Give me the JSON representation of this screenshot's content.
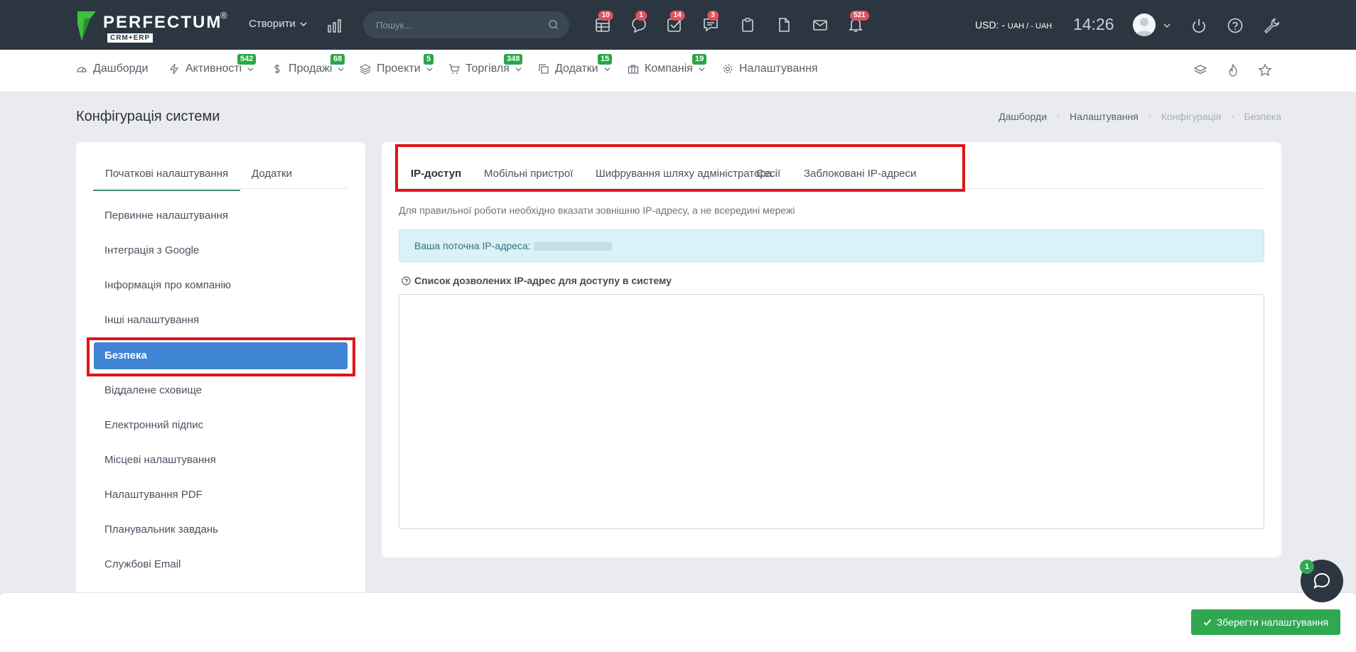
{
  "topbar": {
    "logo_text": "PERFECTUM",
    "logo_reg": "®",
    "logo_sub": "CRM+ERP",
    "create_label": "Створити",
    "search_placeholder": "Пошук...",
    "badges": {
      "tables": "10",
      "chat": "1",
      "tasks": "14",
      "messages": "3",
      "notifications": "521"
    },
    "currency_label": "USD: - ",
    "currency_mid": "UAH / - ",
    "currency_end": "UAH",
    "time": "14:26"
  },
  "nav": {
    "items": [
      {
        "label": "Дашборди"
      },
      {
        "label": "Активності",
        "badge": "542"
      },
      {
        "label": "Продажі",
        "badge": "68"
      },
      {
        "label": "Проекти",
        "badge": "5"
      },
      {
        "label": "Торгівля",
        "badge": "348"
      },
      {
        "label": "Додатки",
        "badge": "15"
      },
      {
        "label": "Компанія",
        "badge": "19"
      },
      {
        "label": "Налаштування"
      }
    ]
  },
  "page": {
    "title": "Конфігурація системи",
    "breadcrumb": [
      "Дашборди",
      "Налаштування",
      "Конфігурація",
      "Безпека"
    ]
  },
  "sidebar": {
    "tabs": [
      "Початкові налаштування",
      "Додатки"
    ],
    "items": [
      "Первинне налаштування",
      "Інтеграція з Google",
      "Інформація про компанію",
      "Інші налаштування",
      "Безпека",
      "Віддалене сховище",
      "Електронний підпис",
      "Місцеві налаштування",
      "Налаштування PDF",
      "Планувальник завдань",
      "Службові Email"
    ]
  },
  "main": {
    "tabs": [
      "IP-доступ",
      "Мобільні пристрої",
      "Шифрування шляху адміністратора",
      "Сесії",
      "Заблоковані IP-адреси"
    ],
    "hint": "Для правильної роботи необхідно вказати зовнішню IP-адресу, а не всередині мережі",
    "ip_label": "Ваша поточна IP-адреса:",
    "allowed_label": "Список дозволених IP-адрес для доступу в систему",
    "allowed_value": ""
  },
  "footer": {
    "save_label": "Зберегти налаштування",
    "chat_badge": "1"
  },
  "colors": {
    "topbar_bg": "#2b3641",
    "accent_blue": "#3f85d3",
    "success_green": "#2fa84f",
    "badge_red": "#e5505d",
    "highlight_red": "#e0131a"
  }
}
